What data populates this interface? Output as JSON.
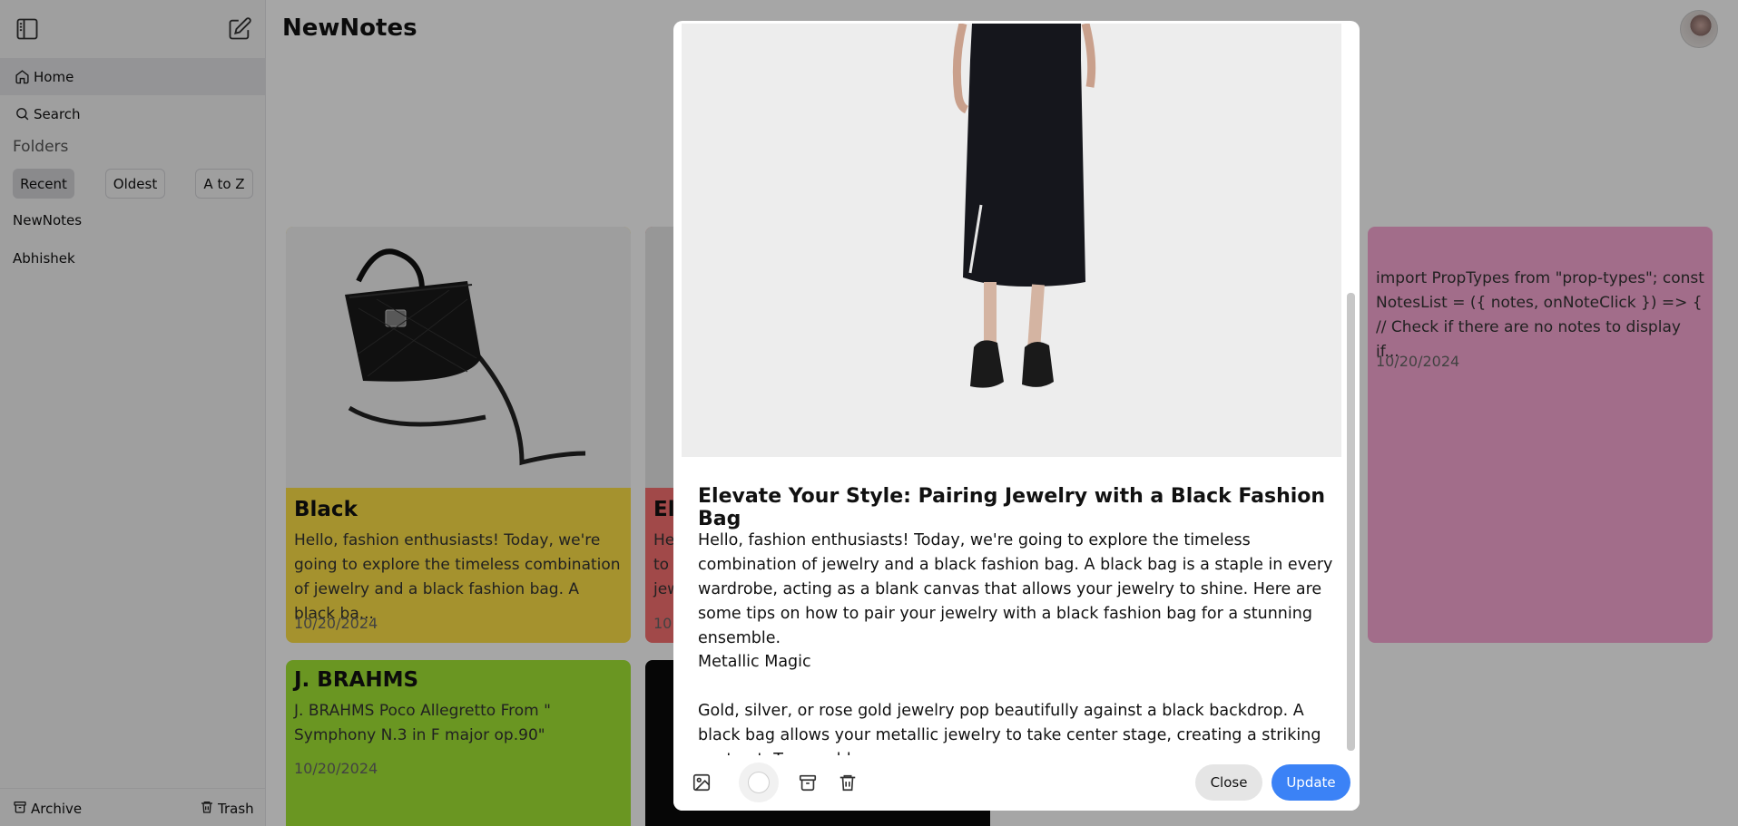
{
  "app": {
    "title": "NewNotes"
  },
  "sidebar": {
    "nav": [
      {
        "label": "Home",
        "icon": "home-icon"
      },
      {
        "label": "Search",
        "icon": "search-icon"
      }
    ],
    "folders_title": "Folders",
    "sort": [
      "Recent",
      "Oldest",
      "A to Z"
    ],
    "folders": [
      "NewNotes",
      "Abhishek"
    ],
    "archive_label": "Archive",
    "trash_label": "Trash"
  },
  "cards": {
    "black": {
      "title": "Black",
      "body": "Hello, fashion enthusiasts! Today, we're going to explore the timeless combination of jewelry and a black fashion bag. A black ba...",
      "date": "10/20/2024",
      "color": "#fde047"
    },
    "ele": {
      "title": "Ele",
      "body": "He\nto\njew",
      "date": "10",
      "color": "#f87171"
    },
    "import": {
      "body": "import PropTypes from \"prop-types\"; const NotesList = ({ notes, onNoteClick }) => { // Check if there are no notes to display if...",
      "date": "10/20/2024",
      "color": "#f9a8d4"
    },
    "brahms": {
      "title": "J. BRAHMS",
      "body": "J. BRAHMS Poco Allegretto From \" Symphony N.3 in F major op.90\"",
      "date": "10/20/2024",
      "color": "#a3e635"
    }
  },
  "modal": {
    "title": "Elevate Your Style: Pairing Jewelry with a Black Fashion Bag",
    "para1": "Hello, fashion enthusiasts! Today, we're going to explore the timeless combination of jewelry and a black fashion bag. A black bag is a staple in every wardrobe, acting as a blank canvas that allows your jewelry to shine. Here are some tips on how to pair your jewelry with a black fashion bag for a stunning ensemble.",
    "para2": "Metallic Magic",
    "para3": "Gold, silver, or rose gold jewelry pop beautifully against a black backdrop. A black bag allows your metallic jewelry to take center stage, creating a striking contrast. Try a gold",
    "close_label": "Close",
    "update_label": "Update",
    "update_color": "#3b82f6"
  }
}
